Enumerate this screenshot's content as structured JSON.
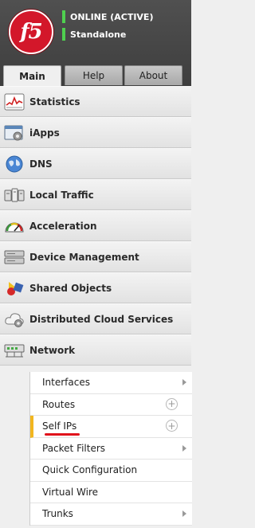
{
  "header": {
    "logo_text": "f5",
    "status_line1": "ONLINE (ACTIVE)",
    "status_line2": "Standalone"
  },
  "tabs": [
    {
      "label": "Main",
      "active": true
    },
    {
      "label": "Help",
      "active": false
    },
    {
      "label": "About",
      "active": false
    }
  ],
  "nav": {
    "items": [
      {
        "label": "Statistics",
        "icon": "statistics-icon"
      },
      {
        "label": "iApps",
        "icon": "iapps-icon"
      },
      {
        "label": "DNS",
        "icon": "dns-globe-icon"
      },
      {
        "label": "Local Traffic",
        "icon": "local-traffic-icon"
      },
      {
        "label": "Acceleration",
        "icon": "acceleration-gauge-icon"
      },
      {
        "label": "Device Management",
        "icon": "device-management-icon"
      },
      {
        "label": "Shared Objects",
        "icon": "shared-objects-icon"
      },
      {
        "label": "Distributed Cloud Services",
        "icon": "cloud-services-icon"
      },
      {
        "label": "Network",
        "icon": "network-icon"
      }
    ]
  },
  "network_submenu": {
    "items": [
      {
        "label": "Interfaces",
        "control": "arrow"
      },
      {
        "label": "Routes",
        "control": "plus"
      },
      {
        "label": "Self IPs",
        "control": "plus",
        "selected": true
      },
      {
        "label": "Packet Filters",
        "control": "arrow"
      },
      {
        "label": "Quick Configuration",
        "control": "none"
      },
      {
        "label": "Virtual Wire",
        "control": "none"
      },
      {
        "label": "Trunks",
        "control": "arrow"
      }
    ],
    "plus_symbol": "+"
  },
  "colors": {
    "header_bg": "#454545",
    "status_green": "#4fd04f",
    "logo_red": "#d3172a",
    "selected_marker": "#f2b61f",
    "annotation_red": "#e0121b"
  }
}
